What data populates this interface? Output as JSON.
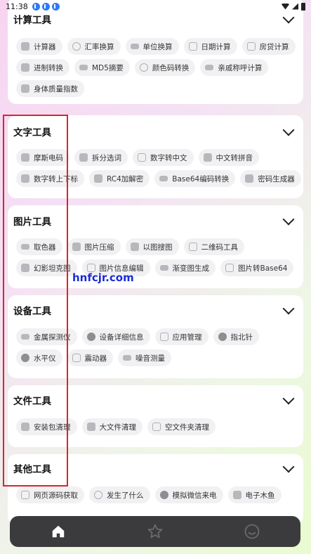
{
  "status": {
    "time": "11:38"
  },
  "sections": [
    {
      "title": "计算工具",
      "rows": [
        [
          {
            "icon": "calculator-icon",
            "label": "计算器"
          },
          {
            "icon": "exchange-rate-icon",
            "label": "汇率换算"
          },
          {
            "icon": "unit-convert-icon",
            "label": "单位换算"
          },
          {
            "icon": "calendar-icon",
            "label": "日期计算"
          },
          {
            "icon": "house-icon",
            "label": "房贷计算"
          }
        ],
        [
          {
            "icon": "binary-icon",
            "label": "进制转换"
          },
          {
            "icon": "md5-icon",
            "label": "MD5摘要"
          },
          {
            "icon": "palette-icon",
            "label": "颜色码转换"
          },
          {
            "icon": "relation-icon",
            "label": "亲戚称呼计算"
          }
        ],
        [
          {
            "icon": "bmi-icon",
            "label": "身体质量指数"
          }
        ]
      ]
    },
    {
      "title": "文字工具",
      "rows": [
        [
          {
            "icon": "morse-icon",
            "label": "摩斯电码"
          },
          {
            "icon": "split-icon",
            "label": "拆分选词"
          },
          {
            "icon": "number-text-icon",
            "label": "数字转中文"
          },
          {
            "icon": "pinyin-icon",
            "label": "中文转拼音"
          }
        ],
        [
          {
            "icon": "subscript-icon",
            "label": "数字转上下标"
          },
          {
            "icon": "rc4-icon",
            "label": "RC4加解密"
          },
          {
            "icon": "link-icon",
            "label": "Base64编码转换"
          },
          {
            "icon": "lock-icon",
            "label": "密码生成器"
          }
        ]
      ]
    },
    {
      "title": "图片工具",
      "rows": [
        [
          {
            "icon": "color-picker-icon",
            "label": "取色器"
          },
          {
            "icon": "image-compress-icon",
            "label": "图片压缩"
          },
          {
            "icon": "image-search-icon",
            "label": "以图搜图"
          },
          {
            "icon": "qrcode-icon",
            "label": "二维码工具"
          }
        ],
        [
          {
            "icon": "phantom-tank-icon",
            "label": "幻影坦克图"
          },
          {
            "icon": "image-edit-icon",
            "label": "图片信息编辑"
          },
          {
            "icon": "gradient-icon",
            "label": "渐变图生成"
          },
          {
            "icon": "image-base64-icon",
            "label": "图片转Base64"
          }
        ]
      ]
    },
    {
      "title": "设备工具",
      "rows": [
        [
          {
            "icon": "metal-detector-icon",
            "label": "金属探测仪"
          },
          {
            "icon": "info-icon",
            "label": "设备详细信息"
          },
          {
            "icon": "package-icon",
            "label": "应用管理"
          },
          {
            "icon": "compass-icon",
            "label": "指北针"
          }
        ],
        [
          {
            "icon": "level-icon",
            "label": "水平仪"
          },
          {
            "icon": "vibrate-icon",
            "label": "震动器"
          },
          {
            "icon": "noise-icon",
            "label": "噪音测量"
          }
        ]
      ]
    },
    {
      "title": "文件工具",
      "rows": [
        [
          {
            "icon": "apk-clean-icon",
            "label": "安装包清理"
          },
          {
            "icon": "folder-icon",
            "label": "大文件清理"
          },
          {
            "icon": "empty-folder-icon",
            "label": "空文件夹清理"
          }
        ]
      ]
    },
    {
      "title": "其他工具",
      "rows": [
        [
          {
            "icon": "web-source-icon",
            "label": "网页源码获取"
          },
          {
            "icon": "smile-icon",
            "label": "发生了什么"
          },
          {
            "icon": "wechat-icon",
            "label": "模拟微信来电"
          },
          {
            "icon": "wooden-fish-icon",
            "label": "电子木鱼"
          }
        ]
      ]
    }
  ],
  "watermark": "hnfcjr.com",
  "nav": [
    {
      "icon": "home-icon"
    },
    {
      "icon": "star-icon"
    },
    {
      "icon": "smile-face-icon"
    }
  ]
}
